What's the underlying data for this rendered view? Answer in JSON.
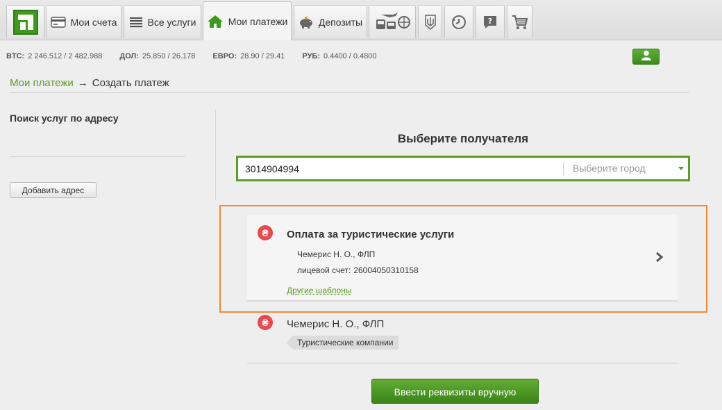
{
  "nav": {
    "tabs": [
      {
        "label": "Мои счета",
        "icon": "card-icon"
      },
      {
        "label": "Все услуги",
        "icon": "list-icon"
      },
      {
        "label": "Мои платежи",
        "icon": "home-icon"
      },
      {
        "label": "Депозиты",
        "icon": "piggy-bank-icon"
      }
    ],
    "icon_tabs": [
      "transport-icon",
      "ukraine-trident-icon",
      "history-icon",
      "help-icon",
      "cart-icon"
    ],
    "accent": "#3d9a1a"
  },
  "rates": [
    {
      "label": "BTC:",
      "value": "2 246.512 / 2 482.988"
    },
    {
      "label": "ДОЛ:",
      "value": "25.850 / 26.178"
    },
    {
      "label": "ЕВРО:",
      "value": "28.90 / 29.41"
    },
    {
      "label": "РУБ:",
      "value": "0.4400 / 0.4800"
    }
  ],
  "breadcrumb": {
    "parent": "Мои платежи",
    "arrow": "→",
    "current": "Создать платеж"
  },
  "sidebar": {
    "title": "Поиск услуг по адресу",
    "add_button": "Добавить адрес"
  },
  "main": {
    "title": "Выберите получателя",
    "search_value": "3014904994",
    "city_placeholder": "Выберите город",
    "results": [
      {
        "title": "Оплата за туристические услуги",
        "name": "Чемерис Н. О., ФЛП",
        "account_label": "лицевой счет:",
        "account": "26004050310158",
        "templates_link": "Другие шаблоны",
        "icon_glyph": "₴"
      },
      {
        "name": "Чемерис Н. О., ФЛП",
        "tag": "Туристические компании",
        "icon_glyph": "₴"
      }
    ],
    "manual_button": "Ввести реквизиты вручную"
  },
  "colors": {
    "highlight": "#f08a36",
    "brand_green": "#5a9e24",
    "hryvnia_red": "#e9494d"
  }
}
